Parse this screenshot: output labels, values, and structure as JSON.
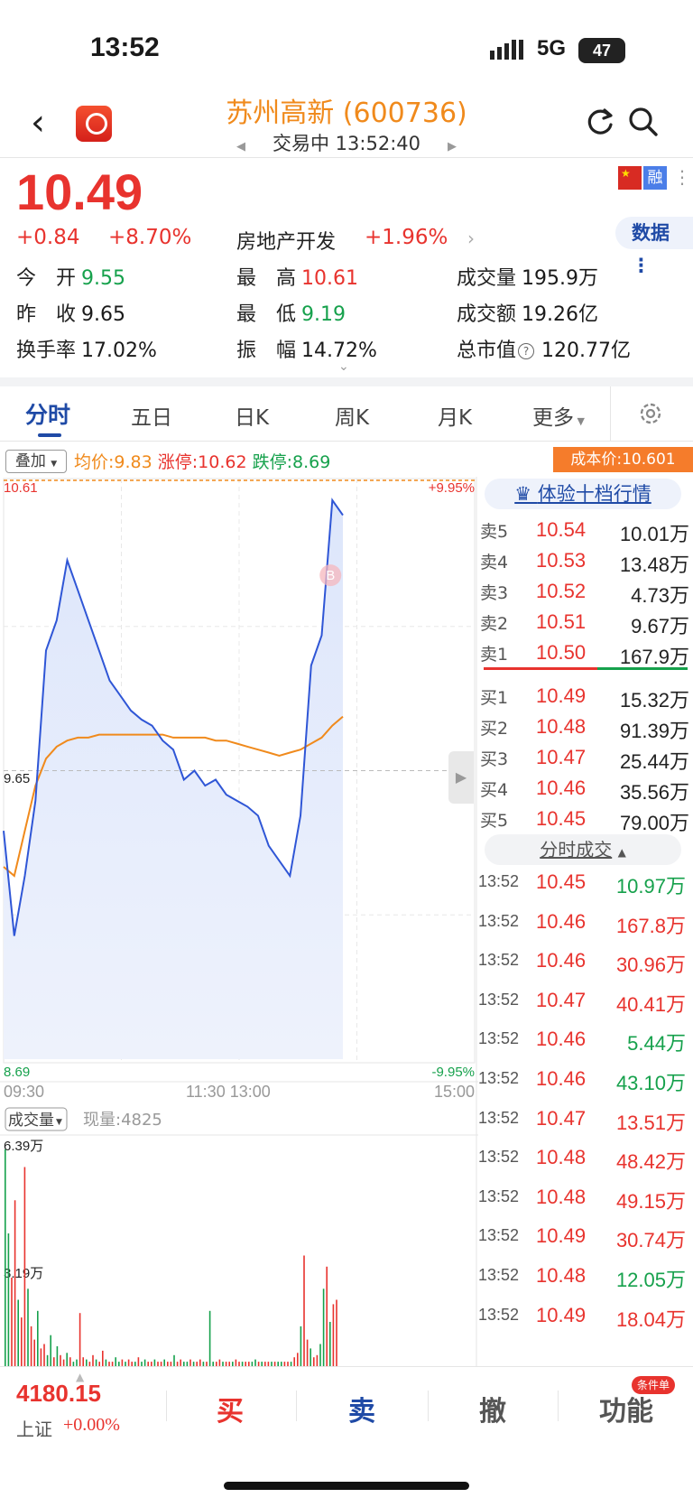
{
  "status_bar": {
    "time": "13:52",
    "network": "5G",
    "battery": "47"
  },
  "header": {
    "title": "苏州高新 (600736)",
    "status": "交易中 13:52:40"
  },
  "quote": {
    "price": "10.49",
    "change": "+0.84",
    "change_pct": "+8.70%",
    "sector": "房地产开发",
    "sector_pct": "+1.96%",
    "badge_rong": "融",
    "data_button": "数据"
  },
  "stats": [
    {
      "label": "今　开",
      "value": "9.55",
      "color": "#16a14c"
    },
    {
      "label": "最　高",
      "value": "10.61",
      "color": "#e8332e"
    },
    {
      "label": "成交量",
      "value": "195.9万",
      "color": "#222222"
    },
    {
      "label": "昨　收",
      "value": "9.65",
      "color": "#222222"
    },
    {
      "label": "最　低",
      "value": "9.19",
      "color": "#16a14c"
    },
    {
      "label": "成交额",
      "value": "19.26亿",
      "color": "#222222"
    },
    {
      "label": "换手率",
      "value": "17.02%",
      "color": "#222222"
    },
    {
      "label": "振　幅",
      "value": "14.72%",
      "color": "#222222"
    },
    {
      "label": "总市值",
      "value": "120.77亿",
      "color": "#222222"
    }
  ],
  "tabs": [
    "分时",
    "五日",
    "日K",
    "周K",
    "月K",
    "更多"
  ],
  "chart_header": {
    "overlay": "叠加",
    "avg": "均价:9.83",
    "limit_up": "涨停:10.62",
    "limit_down": "跌停:8.69",
    "cost": "成本价:10.601"
  },
  "chart_data": {
    "type": "line",
    "y_top_label": "10.61",
    "y_mid_label": "9.65",
    "y_bottom_label": "8.69",
    "pct_top_label": "+9.95%",
    "pct_bottom_label": "-9.95%",
    "x_labels": [
      "09:30",
      "11:30 13:00",
      "15:00"
    ],
    "ylim": [
      8.69,
      10.61
    ],
    "prev_close": 9.65,
    "marker": "B",
    "volume_label": "成交量",
    "current_volume": "现量:4825",
    "volume_top_label": "6.39万",
    "volume_mid_label": "3.19万",
    "series": [
      {
        "values": [
          9.45,
          9.1,
          9.3,
          9.55,
          10.05,
          10.15,
          10.35,
          10.25,
          10.15,
          10.05,
          9.95,
          9.9,
          9.85,
          9.82,
          9.8,
          9.75,
          9.72,
          9.62,
          9.65,
          9.6,
          9.62,
          9.57,
          9.55,
          9.53,
          9.5,
          9.4,
          9.35,
          9.3,
          9.5,
          10.0,
          10.1,
          10.55,
          10.5
        ]
      },
      {
        "values": [
          9.33,
          9.3,
          9.45,
          9.6,
          9.69,
          9.73,
          9.75,
          9.76,
          9.76,
          9.77,
          9.77,
          9.77,
          9.77,
          9.77,
          9.77,
          9.77,
          9.76,
          9.76,
          9.76,
          9.76,
          9.75,
          9.75,
          9.74,
          9.73,
          9.72,
          9.71,
          9.7,
          9.71,
          9.72,
          9.74,
          9.76,
          9.8,
          9.83
        ]
      }
    ]
  },
  "order_book": {
    "button": "体验十档行情",
    "asks": [
      {
        "side": "卖5",
        "price": "10.54",
        "vol": "10.01万"
      },
      {
        "side": "卖4",
        "price": "10.53",
        "vol": "13.48万"
      },
      {
        "side": "卖3",
        "price": "10.52",
        "vol": "4.73万"
      },
      {
        "side": "卖2",
        "price": "10.51",
        "vol": "9.67万"
      },
      {
        "side": "卖1",
        "price": "10.50",
        "vol": "167.9万"
      }
    ],
    "bids": [
      {
        "side": "买1",
        "price": "10.49",
        "vol": "15.32万"
      },
      {
        "side": "买2",
        "price": "10.48",
        "vol": "91.39万"
      },
      {
        "side": "买3",
        "price": "10.47",
        "vol": "25.44万"
      },
      {
        "side": "买4",
        "price": "10.46",
        "vol": "35.56万"
      },
      {
        "side": "买5",
        "price": "10.45",
        "vol": "79.00万"
      }
    ],
    "ticks_toggle": "分时成交",
    "ticks": [
      {
        "time": "13:52",
        "price": "10.45",
        "vol": "10.97万",
        "color": "#16a14c"
      },
      {
        "time": "13:52",
        "price": "10.46",
        "vol": "167.8万",
        "color": "#e8332e"
      },
      {
        "time": "13:52",
        "price": "10.46",
        "vol": "30.96万",
        "color": "#e8332e"
      },
      {
        "time": "13:52",
        "price": "10.47",
        "vol": "40.41万",
        "color": "#e8332e"
      },
      {
        "time": "13:52",
        "price": "10.46",
        "vol": "5.44万",
        "color": "#16a14c"
      },
      {
        "time": "13:52",
        "price": "10.46",
        "vol": "43.10万",
        "color": "#16a14c"
      },
      {
        "time": "13:52",
        "price": "10.47",
        "vol": "13.51万",
        "color": "#e8332e"
      },
      {
        "time": "13:52",
        "price": "10.48",
        "vol": "48.42万",
        "color": "#e8332e"
      },
      {
        "time": "13:52",
        "price": "10.48",
        "vol": "49.15万",
        "color": "#e8332e"
      },
      {
        "time": "13:52",
        "price": "10.49",
        "vol": "30.74万",
        "color": "#e8332e"
      },
      {
        "time": "13:52",
        "price": "10.48",
        "vol": "12.05万",
        "color": "#16a14c"
      },
      {
        "time": "13:52",
        "price": "10.49",
        "vol": "18.04万",
        "color": "#e8332e"
      }
    ]
  },
  "bottom_bar": {
    "index_value": "4180.15",
    "index_name": "上证",
    "index_change": "+0.00%",
    "buy": "买",
    "sell": "卖",
    "cancel": "撤",
    "function": "功能",
    "cond_badge": "条件单"
  },
  "colors": {
    "up": "#e8332e",
    "down": "#16a14c",
    "price_line": "#2f56d6",
    "avg_line": "#f08a1c",
    "accent": "#1f4aa6"
  }
}
